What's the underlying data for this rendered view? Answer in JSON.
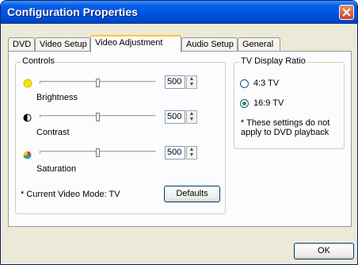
{
  "window": {
    "title": "Configuration Properties"
  },
  "tabs": [
    {
      "label": "DVD",
      "active": false
    },
    {
      "label": "Video Setup",
      "active": false
    },
    {
      "label": "Video Adjustment",
      "active": true
    },
    {
      "label": "Audio Setup",
      "active": false
    },
    {
      "label": "General",
      "active": false
    }
  ],
  "controls": {
    "title": "Controls",
    "brightness": {
      "label": "Brightness",
      "value": "500",
      "icon": "sun-icon",
      "level": 0.5
    },
    "contrast": {
      "label": "Contrast",
      "value": "500",
      "icon": "contrast-icon",
      "level": 0.5
    },
    "saturation": {
      "label": "Saturation",
      "value": "500",
      "icon": "color-wheel-icon",
      "level": 0.5
    },
    "mode_text": "* Current Video Mode: TV",
    "defaults_label": "Defaults"
  },
  "ratio": {
    "title": "TV Display Ratio",
    "options": [
      {
        "label": "4:3 TV",
        "checked": false
      },
      {
        "label": "16:9 TV",
        "checked": true
      }
    ],
    "note": "* These settings do not apply to DVD playback"
  },
  "ok_label": "OK",
  "colors": {
    "title_bar": "#0054e3",
    "close_button": "#d9573a",
    "tab_highlight": "#ffc83c",
    "radio_dot": "#21a121"
  }
}
